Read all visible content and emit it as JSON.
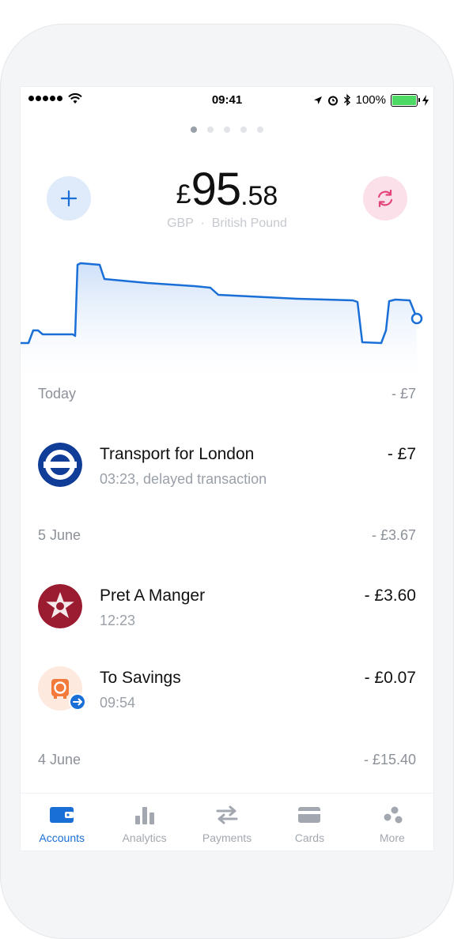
{
  "status_bar": {
    "time": "09:41",
    "battery_text": "100%",
    "battery_level": 1.0
  },
  "pager": {
    "pages": 5,
    "active_index": 0
  },
  "balance": {
    "currency_symbol": "£",
    "integer": "95",
    "decimal": ".58",
    "code": "GBP",
    "separator": "·",
    "currency_name": "British Pound"
  },
  "accent_color": "#1a6fd6",
  "sections": [
    {
      "label": "Today",
      "total": "- £7"
    },
    {
      "label": "5 June",
      "total": "- £3.67"
    },
    {
      "label": "4 June",
      "total": "- £15.40"
    }
  ],
  "transactions": [
    {
      "name": "Transport for London",
      "detail": "03:23, delayed transaction",
      "amount": "- £7",
      "icon": "tfl-roundel-icon"
    },
    {
      "name": "Pret A Manger",
      "detail": "12:23",
      "amount": "- £3.60",
      "icon": "pret-star-icon"
    },
    {
      "name": "To Savings",
      "detail": "09:54",
      "amount": "- £0.07",
      "icon": "savings-vault-icon"
    }
  ],
  "tabs": [
    {
      "label": "Accounts",
      "icon": "wallet-icon",
      "active": true
    },
    {
      "label": "Analytics",
      "icon": "bar-chart-icon",
      "active": false
    },
    {
      "label": "Payments",
      "icon": "transfer-arrows-icon",
      "active": false
    },
    {
      "label": "Cards",
      "icon": "card-icon",
      "active": false
    },
    {
      "label": "More",
      "icon": "more-dots-icon",
      "active": false
    }
  ]
}
